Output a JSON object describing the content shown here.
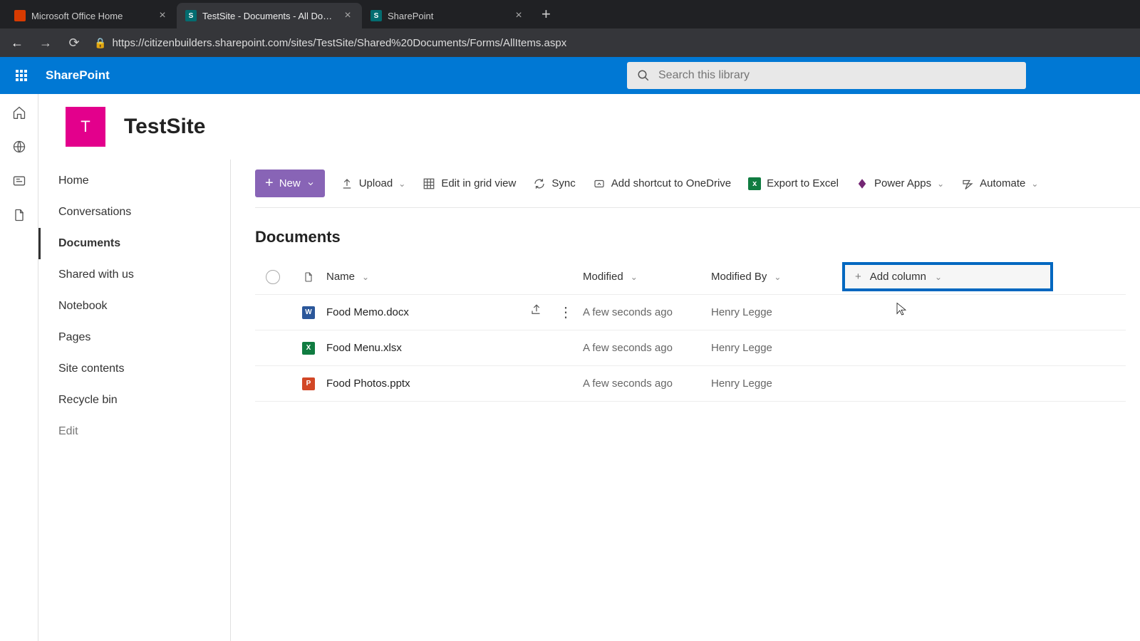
{
  "browser": {
    "tabs": [
      {
        "title": "Microsoft Office Home",
        "favicon_color": "#d83b01",
        "favicon_letter": ""
      },
      {
        "title": "TestSite - Documents - All Docum",
        "favicon_color": "#036c70",
        "favicon_letter": "S"
      },
      {
        "title": "SharePoint",
        "favicon_color": "#036c70",
        "favicon_letter": "S"
      }
    ],
    "url": "https://citizenbuilders.sharepoint.com/sites/TestSite/Shared%20Documents/Forms/AllItems.aspx"
  },
  "suite": {
    "brand": "SharePoint",
    "search_placeholder": "Search this library"
  },
  "site": {
    "logo_letter": "T",
    "logo_color": "#e3008c",
    "title": "TestSite"
  },
  "leftnav": {
    "items": [
      "Home",
      "Conversations",
      "Documents",
      "Shared with us",
      "Notebook",
      "Pages",
      "Site contents",
      "Recycle bin"
    ],
    "edit": "Edit",
    "active": "Documents"
  },
  "commands": {
    "new": "New",
    "upload": "Upload",
    "edit_grid": "Edit in grid view",
    "sync": "Sync",
    "add_shortcut": "Add shortcut to OneDrive",
    "export_excel": "Export to Excel",
    "power_apps": "Power Apps",
    "automate": "Automate"
  },
  "page": {
    "title": "Documents"
  },
  "table": {
    "columns": {
      "name": "Name",
      "modified": "Modified",
      "modified_by": "Modified By",
      "add_column": "Add column"
    },
    "rows": [
      {
        "icon": "word",
        "name": "Food Memo.docx",
        "modified": "A few seconds ago",
        "modified_by": "Henry Legge",
        "hovered": true
      },
      {
        "icon": "xlsx",
        "name": "Food Menu.xlsx",
        "modified": "A few seconds ago",
        "modified_by": "Henry Legge",
        "hovered": false
      },
      {
        "icon": "pptx",
        "name": "Food Photos.pptx",
        "modified": "A few seconds ago",
        "modified_by": "Henry Legge",
        "hovered": false
      }
    ]
  }
}
